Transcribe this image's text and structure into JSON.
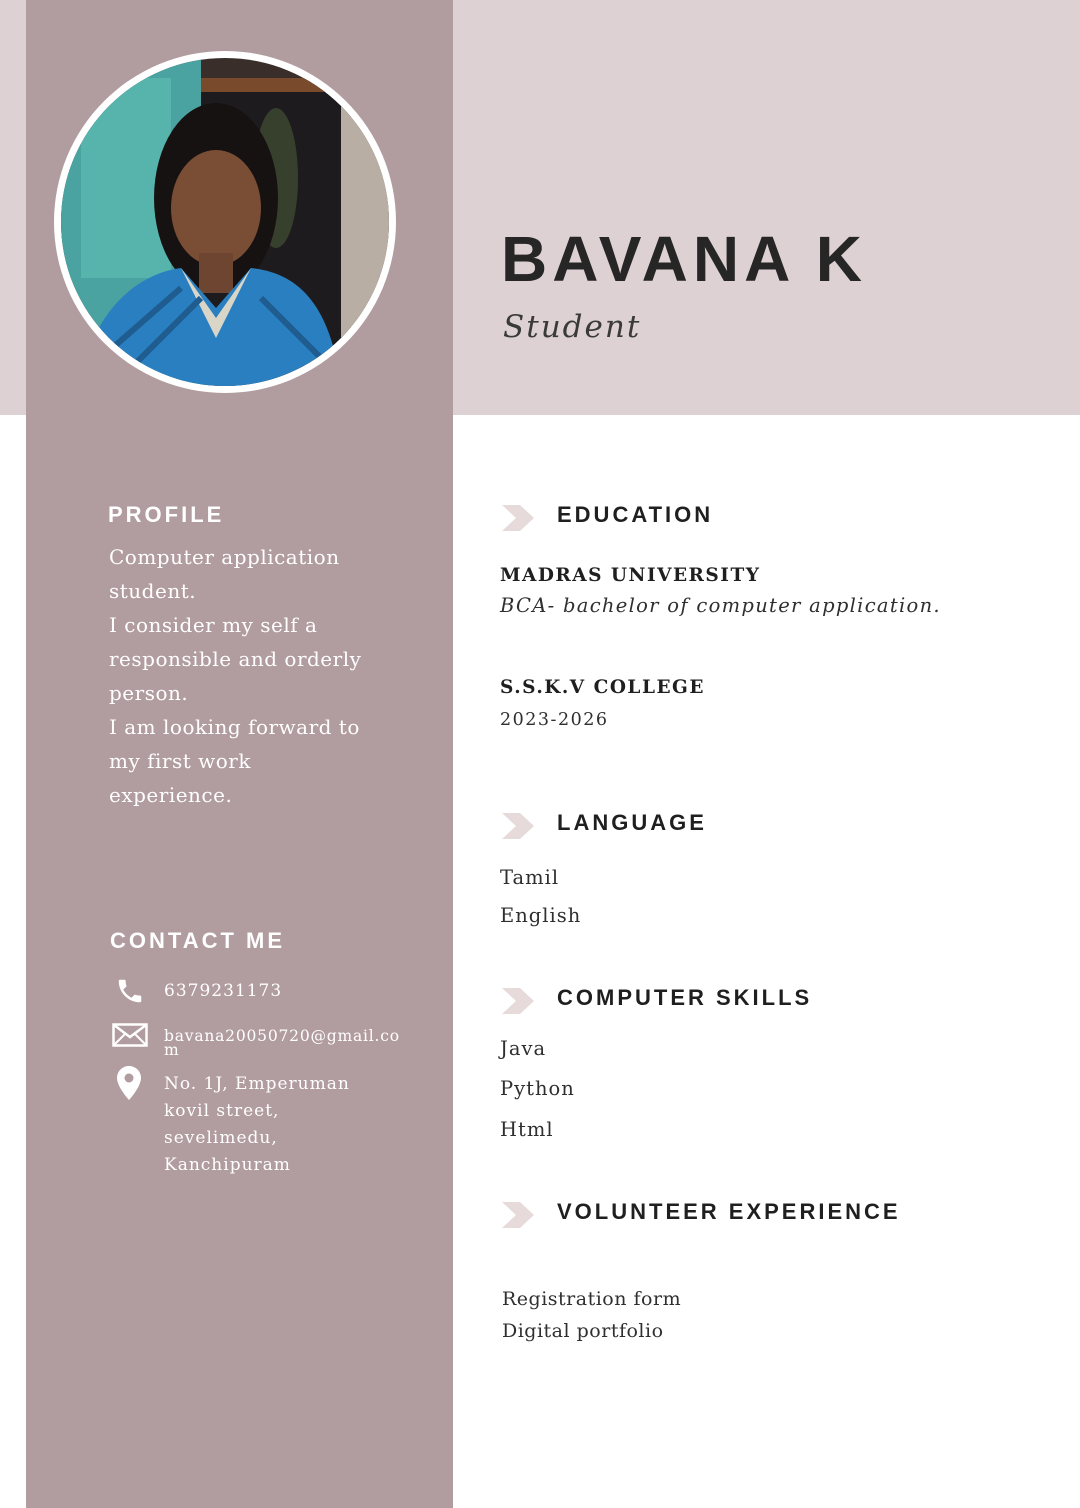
{
  "header": {
    "name": "BAVANA K",
    "title": "Student"
  },
  "photo": {
    "icon": "portrait-photo"
  },
  "profile": {
    "heading": "PROFILE",
    "lines": [
      "Computer application",
      "student.",
      "I consider my self a",
      "responsible and orderly",
      "person.",
      "I am looking forward to",
      "my first work",
      "experience."
    ]
  },
  "contact": {
    "heading": "CONTACT ME",
    "phone": "6379231173",
    "email_line1": "bavana20050720@gmail.co",
    "email_line2": "m",
    "address": [
      "No. 1J, Emperuman",
      "kovil street,",
      "sevelimedu,",
      "Kanchipuram"
    ],
    "icons": [
      "phone-icon",
      "envelope-icon",
      "location-pin-icon"
    ]
  },
  "education": {
    "heading": "EDUCATION",
    "institution1": "MADRAS UNIVERSITY",
    "degree": "BCA- bachelor of computer application.",
    "institution2": "S.S.K.V  COLLEGE",
    "years": "2023-2026"
  },
  "language": {
    "heading": "LANGUAGE",
    "items": [
      "Tamil",
      "English"
    ]
  },
  "skills": {
    "heading": "COMPUTER SKILLS",
    "items": [
      "Java",
      "Python",
      "Html"
    ]
  },
  "volunteer": {
    "heading": "VOLUNTEER EXPERIENCE",
    "items": [
      "Registration form",
      "Digital portfolio"
    ]
  },
  "colors": {
    "header_bg": "#ddd1d3",
    "sidebar_bg": "#b19c9f",
    "chevron": "#e6dadb",
    "heading_text": "#1f1f1f"
  }
}
